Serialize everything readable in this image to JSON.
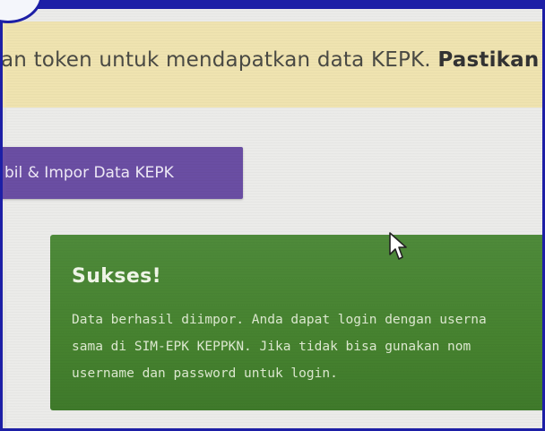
{
  "alert_warning": {
    "text_regular": "an token untuk mendapatkan data KEPK. ",
    "text_bold": "Pastikan I"
  },
  "import_button": {
    "label": "bil & Impor Data KEPK"
  },
  "alert_success": {
    "title": "Sukses!",
    "lines": [
      "Data berhasil diimpor. Anda dapat login dengan userna",
      "sama di SIM-EPK KEPPKN. Jika tidak bisa gunakan nom",
      "username dan password untuk login."
    ]
  },
  "colors": {
    "warning_bg": "#efe3b0",
    "button_bg": "#6a4ea3",
    "success_bg": "#46822f",
    "frame_border": "#1d1fa6"
  },
  "icons": {
    "cursor": "mouse-pointer-icon"
  }
}
